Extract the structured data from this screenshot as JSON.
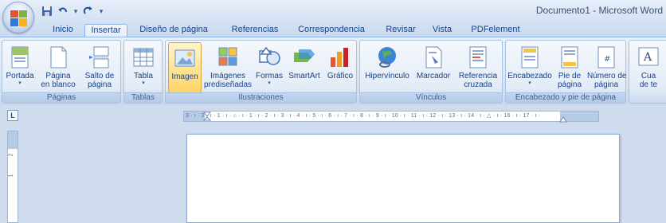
{
  "window": {
    "title": "Documento1 - Microsoft Word"
  },
  "quick_access": {
    "save_icon": "save-icon",
    "undo_icon": "undo-icon",
    "redo_icon": "redo-icon",
    "customize_icon": "customize-qat-icon"
  },
  "tabs": [
    {
      "label": "Inicio"
    },
    {
      "label": "Insertar"
    },
    {
      "label": "Diseño de página"
    },
    {
      "label": "Referencias"
    },
    {
      "label": "Correspondencia"
    },
    {
      "label": "Revisar"
    },
    {
      "label": "Vista"
    },
    {
      "label": "PDFelement"
    }
  ],
  "active_tab": "Insertar",
  "ribbon": {
    "paginas": {
      "label": "Páginas",
      "buttons": [
        {
          "label": "Portada"
        },
        {
          "label1": "Página",
          "label2": "en blanco"
        },
        {
          "label1": "Salto de",
          "label2": "página"
        }
      ]
    },
    "tablas": {
      "label": "Tablas",
      "buttons": [
        {
          "label": "Tabla"
        }
      ]
    },
    "ilustraciones": {
      "label": "Ilustraciones",
      "buttons": [
        {
          "label": "Imagen"
        },
        {
          "label1": "Imágenes",
          "label2": "prediseñadas"
        },
        {
          "label": "Formas"
        },
        {
          "label": "SmartArt"
        },
        {
          "label": "Gráfico"
        }
      ]
    },
    "vinculos": {
      "label": "Vínculos",
      "buttons": [
        {
          "label": "Hipervínculo"
        },
        {
          "label": "Marcador"
        },
        {
          "label1": "Referencia",
          "label2": "cruzada"
        }
      ]
    },
    "encabezado": {
      "label": "Encabezado y pie de página",
      "buttons": [
        {
          "label": "Encabezado"
        },
        {
          "label1": "Pie de",
          "label2": "página"
        },
        {
          "label1": "Número de",
          "label2": "página"
        }
      ]
    },
    "texto": {
      "buttons": [
        {
          "label1": "Cua",
          "label2": "de te"
        }
      ]
    }
  },
  "ruler": {
    "tab_selector": "L",
    "ticks": "3 · ı · 2 · ı · 1 · ı · ⌂ · ı · 1 · ı · 2 · ı · 3 · ı · 4 · ı · 5 · ı · 6 · ı · 7 · ı · 8 · ı · 9 · ı · 10 · ı · 11 · ı · 12 · ı · 13 · ı · 14 · ı · △ · ı · 16 · ı · 17 · ı ·",
    "vertical_numbers": [
      "2",
      "1"
    ]
  }
}
